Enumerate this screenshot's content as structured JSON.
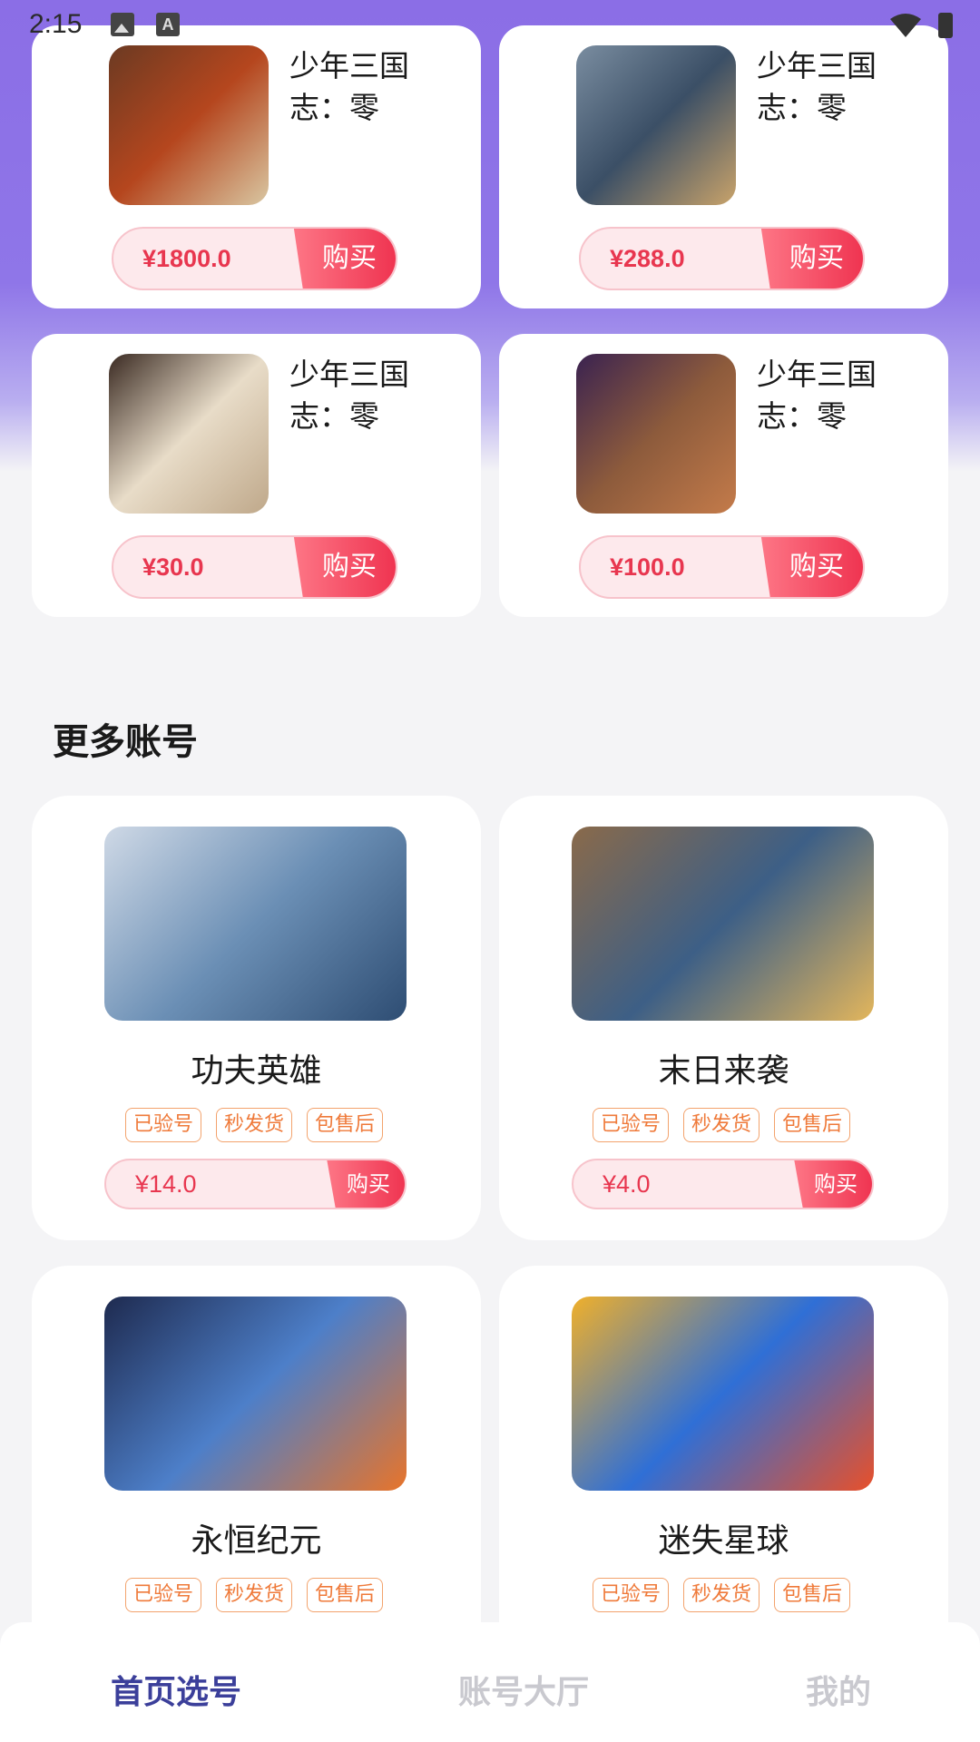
{
  "status_bar": {
    "time": "2:15",
    "status_letter": "A"
  },
  "top_products": [
    {
      "title": "少年三国志：零",
      "price": "¥1800.0",
      "buy_label": "购买",
      "thumb_colors": [
        "#6b3a22",
        "#b5461e",
        "#d9c7a2"
      ]
    },
    {
      "title": "少年三国志：零",
      "price": "¥288.0",
      "buy_label": "购买",
      "thumb_colors": [
        "#7a8da0",
        "#3b4f66",
        "#c9a36a"
      ]
    },
    {
      "title": "少年三国志：零",
      "price": "¥30.0",
      "buy_label": "购买",
      "thumb_colors": [
        "#3a2a22",
        "#e8dcc8",
        "#bfa88a"
      ]
    },
    {
      "title": "少年三国志：零",
      "price": "¥100.0",
      "buy_label": "购买",
      "thumb_colors": [
        "#3a2250",
        "#8d5b3c",
        "#c47b4a"
      ]
    }
  ],
  "more_section": {
    "title": "更多账号"
  },
  "more_products": [
    {
      "title": "功夫英雄",
      "tags": [
        "已验号",
        "秒发货",
        "包售后"
      ],
      "price": "¥14.0",
      "buy_label": "购买",
      "thumb_colors": [
        "#cfd9e6",
        "#6b8fb5",
        "#2e4d73"
      ]
    },
    {
      "title": "末日来袭",
      "tags": [
        "已验号",
        "秒发货",
        "包售后"
      ],
      "price": "¥4.0",
      "buy_label": "购买",
      "thumb_colors": [
        "#8a6a4a",
        "#3d5f86",
        "#e3b65c"
      ]
    },
    {
      "title": "永恒纪元",
      "tags": [
        "已验号",
        "秒发货",
        "包售后"
      ],
      "price": "",
      "buy_label": "",
      "thumb_colors": [
        "#1e2a4f",
        "#4d7fc9",
        "#e8742a"
      ]
    },
    {
      "title": "迷失星球",
      "tags": [
        "已验号",
        "秒发货",
        "包售后"
      ],
      "price": "",
      "buy_label": "",
      "thumb_colors": [
        "#f0b02a",
        "#2f6fd6",
        "#e8502a"
      ]
    }
  ],
  "tabbar": {
    "tabs": [
      {
        "label": "首页选号",
        "active": true
      },
      {
        "label": "账号大厅",
        "active": false
      },
      {
        "label": "我的",
        "active": false
      }
    ]
  },
  "colors": {
    "accent": "#ef3350",
    "tab_active": "#3b3f9a",
    "tag": "#ef7a3a",
    "header_purple": "#8b6ee6"
  }
}
